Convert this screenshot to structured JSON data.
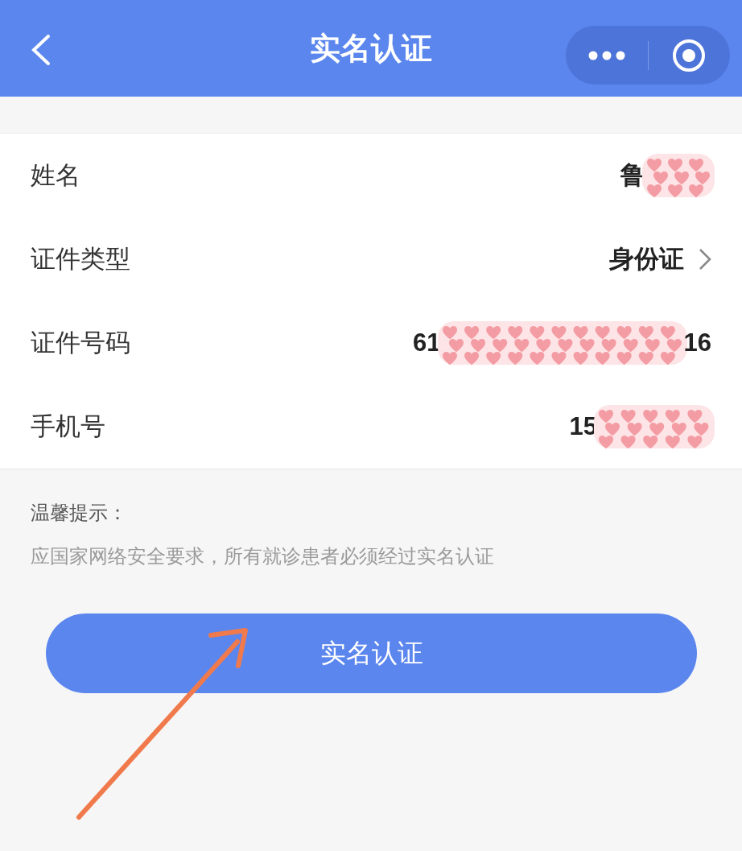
{
  "nav": {
    "title": "实名认证"
  },
  "fields": [
    {
      "label": "姓名",
      "kind": "redacted",
      "before": "鲁"
    },
    {
      "label": "证件类型",
      "kind": "select",
      "value": "身份证"
    },
    {
      "label": "证件号码",
      "kind": "redacted",
      "before": "61",
      "after": "16"
    },
    {
      "label": "手机号",
      "kind": "redacted",
      "before": "15"
    }
  ],
  "notice": {
    "title": "温馨提示：",
    "text": "应国家网络安全要求，所有就诊患者必须经过实名认证"
  },
  "submit": {
    "label": "实名认证"
  }
}
